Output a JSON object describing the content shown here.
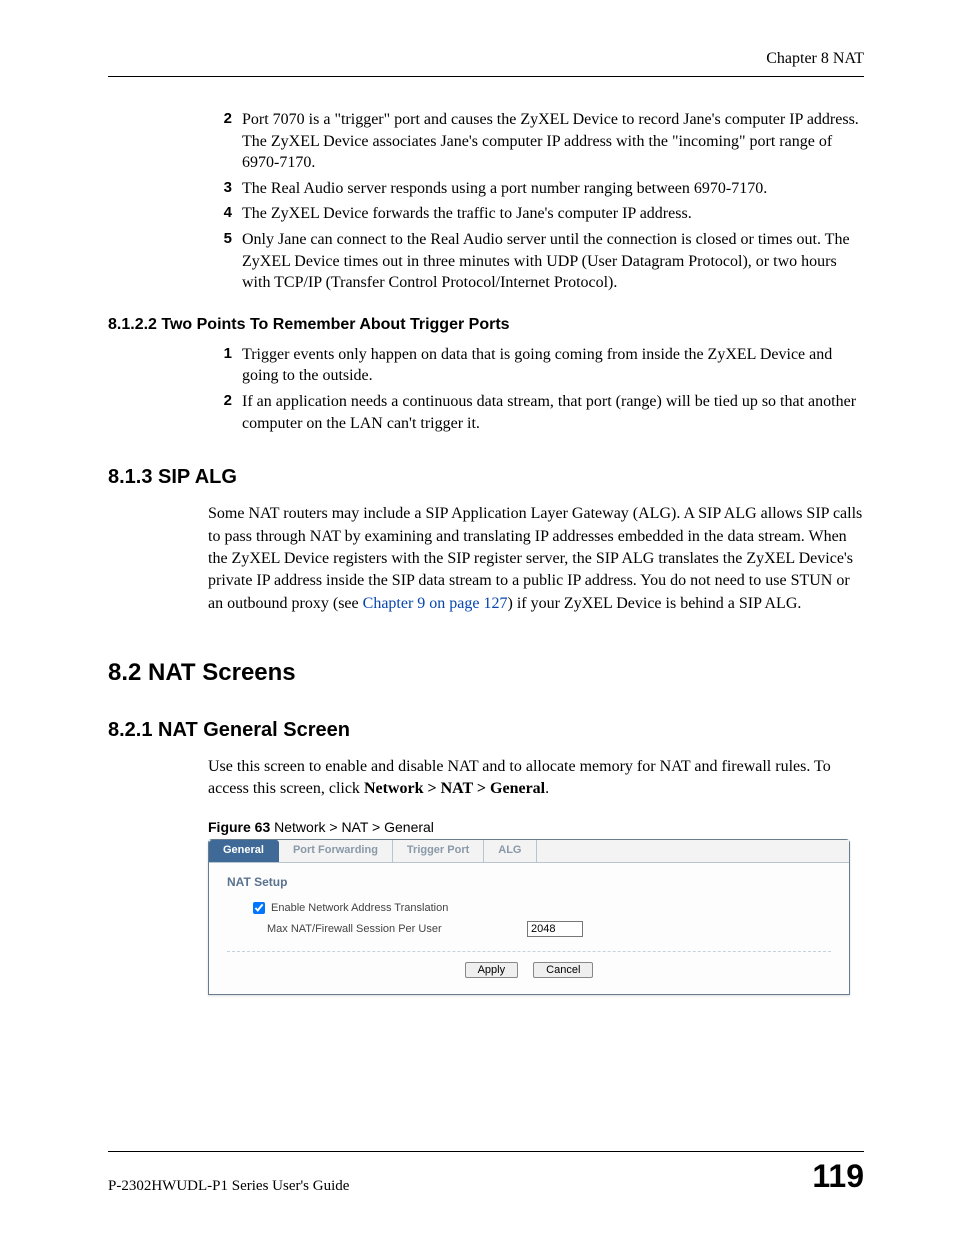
{
  "header": {
    "chapter": "Chapter 8 NAT"
  },
  "list_a": {
    "items": [
      {
        "n": "2",
        "t": "Port 7070 is a \"trigger\" port and causes the ZyXEL Device to record Jane's computer IP address. The ZyXEL Device associates Jane's computer IP address with the \"incoming\" port range of 6970-7170."
      },
      {
        "n": "3",
        "t": "The Real Audio server responds using a port number ranging between 6970-7170."
      },
      {
        "n": "4",
        "t": "The ZyXEL Device forwards the traffic to Jane's computer IP address."
      },
      {
        "n": "5",
        "t": "Only Jane can connect to the Real Audio server until the connection is closed or times out. The ZyXEL Device times out in three minutes with UDP (User Datagram Protocol), or two hours with TCP/IP (Transfer Control Protocol/Internet Protocol)."
      }
    ]
  },
  "sec_8_1_2_2": {
    "title": "8.1.2.2  Two Points To Remember About Trigger Ports",
    "items": [
      {
        "n": "1",
        "t": "Trigger events only happen on data that is going coming from inside the ZyXEL Device and going to the outside."
      },
      {
        "n": "2",
        "t": "If an application needs a continuous data stream, that port (range) will be tied up so that another computer on the LAN can't trigger it."
      }
    ]
  },
  "sec_8_1_3": {
    "title": "8.1.3  SIP ALG",
    "body_a": "Some NAT routers may include a SIP Application Layer Gateway (ALG). A SIP ALG allows SIP calls to pass through NAT by examining and translating IP addresses embedded in the data stream. When the ZyXEL Device registers with the SIP register server, the SIP ALG translates the ZyXEL Device's private IP address inside the SIP data stream to a public IP address. You do not need to use STUN or an outbound proxy (see ",
    "link": "Chapter 9 on page 127",
    "body_b": ") if your ZyXEL Device is behind a SIP ALG."
  },
  "sec_8_2": {
    "title": "8.2  NAT Screens"
  },
  "sec_8_2_1": {
    "title": "8.2.1  NAT General Screen",
    "body_a": "Use this screen to enable and disable NAT and to allocate memory for NAT and firewall rules. To access this screen, click ",
    "navpath": "Network > NAT > General",
    "body_b": "."
  },
  "figure": {
    "label": "Figure 63",
    "caption": "   Network > NAT > General",
    "tabs": [
      "General",
      "Port Forwarding",
      "Trigger Port",
      "ALG"
    ],
    "panel_title": "NAT Setup",
    "enable_label": "Enable Network Address Translation",
    "max_label": "Max NAT/Firewall Session Per User",
    "max_value": "2048",
    "apply": "Apply",
    "cancel": "Cancel"
  },
  "footer": {
    "guide": "P-2302HWUDL-P1 Series User's Guide",
    "page": "119"
  }
}
